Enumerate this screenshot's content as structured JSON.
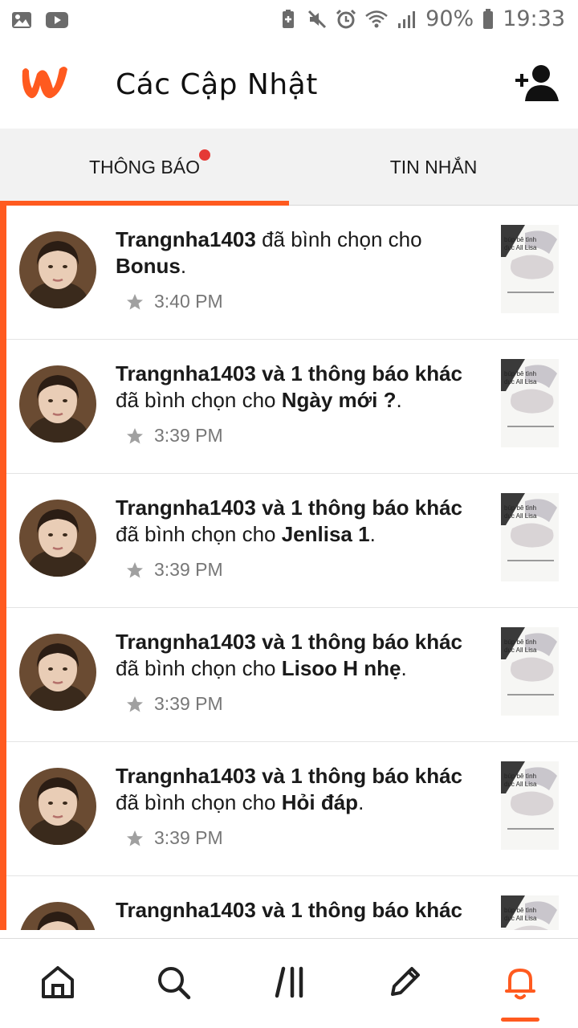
{
  "status_bar": {
    "battery": "90%",
    "time": "19:33",
    "left_icons": [
      "image-icon",
      "youtube-icon"
    ],
    "right_icons": [
      "battery-saver-icon",
      "mute-icon",
      "alarm-icon",
      "wifi-icon",
      "signal-icon",
      "battery-icon"
    ]
  },
  "header": {
    "title": "Các Cập Nhật",
    "logo": "wattpad-logo",
    "action_icon": "add-user-icon"
  },
  "tabs": [
    {
      "label": "THÔNG BÁO",
      "active": true,
      "has_dot": true
    },
    {
      "label": "TIN NHẮN",
      "active": false,
      "has_dot": false
    }
  ],
  "notifications": [
    {
      "user": "Trangnha1403",
      "middle": " đã bình chọn cho ",
      "story": "Bonus",
      "end": ".",
      "time": "3:40 PM"
    },
    {
      "user": "Trangnha1403 và 1 thông báo khác",
      "middle": " đã bình chọn cho ",
      "story": "Ngày mới ?",
      "end": ".",
      "time": "3:39 PM"
    },
    {
      "user": "Trangnha1403 và 1 thông báo khác",
      "middle": " đã bình chọn cho ",
      "story": "Jenlisa 1",
      "end": ".",
      "time": "3:39 PM"
    },
    {
      "user": "Trangnha1403 và 1 thông báo khác",
      "middle": " đã bình chọn cho ",
      "story": "Lisoo H nhẹ",
      "end": ".",
      "time": "3:39 PM"
    },
    {
      "user": "Trangnha1403 và 1 thông báo khác",
      "middle": " đã bình chọn cho ",
      "story": "Hỏi đáp",
      "end": ".",
      "time": "3:39 PM"
    },
    {
      "user": "Trangnha1403 và 1 thông báo khác",
      "middle": "",
      "story": "",
      "end": "",
      "time": ""
    }
  ],
  "thumb_text": "búp bê tình\ndục All Lisa",
  "bottom_nav": [
    {
      "icon": "home-icon",
      "active": false
    },
    {
      "icon": "search-icon",
      "active": false
    },
    {
      "icon": "library-icon",
      "active": false
    },
    {
      "icon": "write-icon",
      "active": false
    },
    {
      "icon": "bell-icon",
      "active": true
    }
  ],
  "colors": {
    "accent": "#ff5a1f",
    "dot": "#e53935"
  }
}
